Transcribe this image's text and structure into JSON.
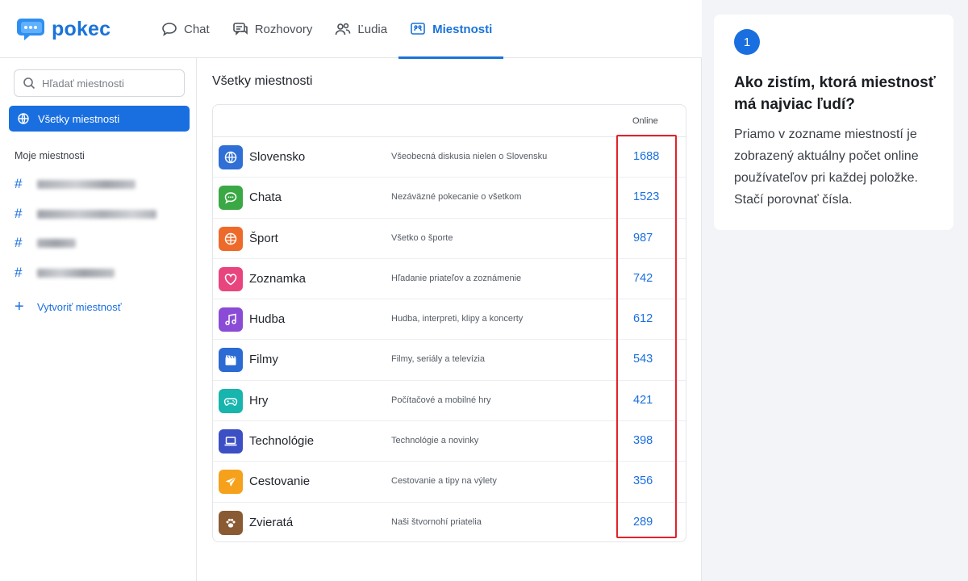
{
  "app": {
    "name": "pokec"
  },
  "nav": [
    {
      "label": "Chat",
      "icon": "chat-bubble-icon",
      "active": false
    },
    {
      "label": "Rozhovory",
      "icon": "conversations-icon",
      "active": false
    },
    {
      "label": "Ľudia",
      "icon": "people-icon",
      "active": false
    },
    {
      "label": "Miestnosti",
      "icon": "rooms-icon",
      "active": true
    }
  ],
  "sidebar": {
    "search_placeholder": "Hľadať miestnosti",
    "all_rooms_label": "Všetky miestnosti",
    "my_rooms_heading": "Moje miestnosti",
    "my_rooms_note": "room names are pixelated/blurred in the screenshot",
    "create_label": "Vytvoriť miestnosť"
  },
  "main": {
    "title": "Všetky miestnosti",
    "online_header": "Online",
    "rooms": [
      {
        "name": "Slovensko",
        "desc": "Všeobecná diskusia nielen o Slovensku",
        "online": "1688",
        "icon": "globe-icon",
        "color": "#2f6fd6"
      },
      {
        "name": "Chata",
        "desc": "Nezáväzné pokecanie o všetkom",
        "online": "1523",
        "icon": "chat-icon",
        "color": "#3aa845"
      },
      {
        "name": "Šport",
        "desc": "Všetko o športe",
        "online": "987",
        "icon": "ball-icon",
        "color": "#ee6a2a"
      },
      {
        "name": "Zoznamka",
        "desc": "Hľadanie priateľov a zoznámenie",
        "online": "742",
        "icon": "heart-icon",
        "color": "#e8457e"
      },
      {
        "name": "Hudba",
        "desc": "Hudba, interpreti, klipy a koncerty",
        "online": "612",
        "icon": "music-icon",
        "color": "#8a4bd6"
      },
      {
        "name": "Filmy",
        "desc": "Filmy, seriály a televízia",
        "online": "543",
        "icon": "clapperboard-icon",
        "color": "#2b6bd3"
      },
      {
        "name": "Hry",
        "desc": "Počítačové a mobilné hry",
        "online": "421",
        "icon": "gamepad-icon",
        "color": "#17b5ae"
      },
      {
        "name": "Technológie",
        "desc": "Technológie a novinky",
        "online": "398",
        "icon": "laptop-icon",
        "color": "#3d4fc4"
      },
      {
        "name": "Cestovanie",
        "desc": "Cestovanie a tipy na výlety",
        "online": "356",
        "icon": "plane-icon",
        "color": "#f5a11c"
      },
      {
        "name": "Zvieratá",
        "desc": "Naši štvornohí priatelia",
        "online": "289",
        "icon": "paw-icon",
        "color": "#8a5a33"
      }
    ]
  },
  "help": {
    "step": "1",
    "title": "Ako zistím, ktorá miestnosť má najviac ľudí?",
    "text": "Priamo v zozname miestností je zobrazený aktuálny počet online používateľov pri každej položke. Stačí porovnať čísla."
  },
  "colors": {
    "accent": "#1a6fe0",
    "highlight": "#e2232a"
  }
}
